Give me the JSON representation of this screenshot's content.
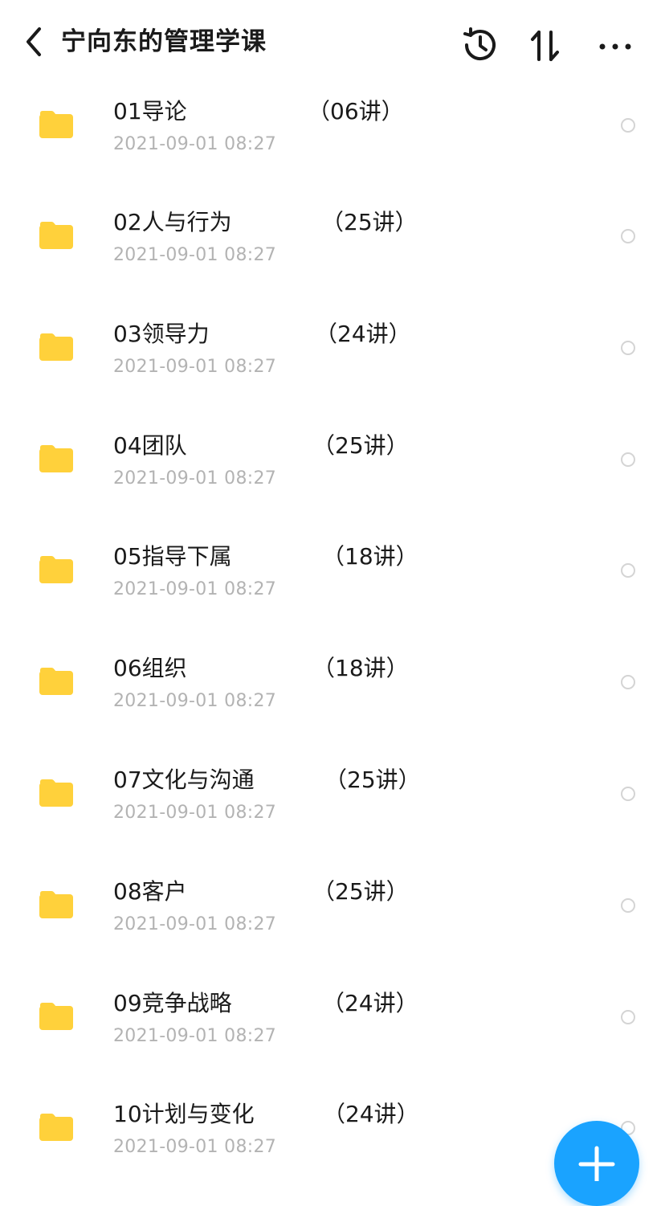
{
  "header": {
    "title": "宁向东的管理学课"
  },
  "icons": {
    "back": "chevron-left-icon",
    "history": "history-clock-icon",
    "sort": "sort-arrows-icon",
    "more": "more-dots-icon",
    "folder": "folder-icon",
    "add": "plus-icon"
  },
  "colors": {
    "folder": "#ffd13b",
    "accent": "#1aa3ff",
    "date_text": "#b3b3b3"
  },
  "folders": [
    {
      "name": "01导论",
      "count": "（06讲）",
      "date": "2021-09-01 08:27"
    },
    {
      "name": "02人与行为",
      "count": "（25讲）",
      "date": "2021-09-01 08:27"
    },
    {
      "name": "03领导力",
      "count": "（24讲）",
      "date": "2021-09-01 08:27"
    },
    {
      "name": "04团队",
      "count": "（25讲）",
      "date": "2021-09-01 08:27"
    },
    {
      "name": "05指导下属",
      "count": "（18讲）",
      "date": "2021-09-01 08:27"
    },
    {
      "name": "06组织",
      "count": "（18讲）",
      "date": "2021-09-01 08:27"
    },
    {
      "name": "07文化与沟通",
      "count": "（25讲）",
      "date": "2021-09-01 08:27"
    },
    {
      "name": "08客户",
      "count": "（25讲）",
      "date": "2021-09-01 08:27"
    },
    {
      "name": "09竞争战略",
      "count": "（24讲）",
      "date": "2021-09-01 08:27"
    },
    {
      "name": "10计划与变化",
      "count": "（24讲）",
      "date": "2021-09-01 08:27"
    }
  ]
}
